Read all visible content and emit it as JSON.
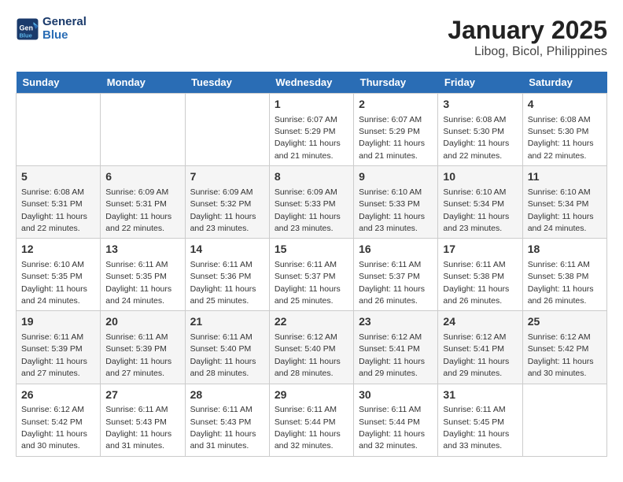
{
  "header": {
    "logo_line1": "General",
    "logo_line2": "Blue",
    "title": "January 2025",
    "subtitle": "Libog, Bicol, Philippines"
  },
  "days_of_week": [
    "Sunday",
    "Monday",
    "Tuesday",
    "Wednesday",
    "Thursday",
    "Friday",
    "Saturday"
  ],
  "weeks": [
    [
      {
        "day": "",
        "info": ""
      },
      {
        "day": "",
        "info": ""
      },
      {
        "day": "",
        "info": ""
      },
      {
        "day": "1",
        "sunrise": "6:07 AM",
        "sunset": "5:29 PM",
        "daylight": "11 hours and 21 minutes."
      },
      {
        "day": "2",
        "sunrise": "6:07 AM",
        "sunset": "5:29 PM",
        "daylight": "11 hours and 21 minutes."
      },
      {
        "day": "3",
        "sunrise": "6:08 AM",
        "sunset": "5:30 PM",
        "daylight": "11 hours and 22 minutes."
      },
      {
        "day": "4",
        "sunrise": "6:08 AM",
        "sunset": "5:30 PM",
        "daylight": "11 hours and 22 minutes."
      }
    ],
    [
      {
        "day": "5",
        "sunrise": "6:08 AM",
        "sunset": "5:31 PM",
        "daylight": "11 hours and 22 minutes."
      },
      {
        "day": "6",
        "sunrise": "6:09 AM",
        "sunset": "5:31 PM",
        "daylight": "11 hours and 22 minutes."
      },
      {
        "day": "7",
        "sunrise": "6:09 AM",
        "sunset": "5:32 PM",
        "daylight": "11 hours and 23 minutes."
      },
      {
        "day": "8",
        "sunrise": "6:09 AM",
        "sunset": "5:33 PM",
        "daylight": "11 hours and 23 minutes."
      },
      {
        "day": "9",
        "sunrise": "6:10 AM",
        "sunset": "5:33 PM",
        "daylight": "11 hours and 23 minutes."
      },
      {
        "day": "10",
        "sunrise": "6:10 AM",
        "sunset": "5:34 PM",
        "daylight": "11 hours and 23 minutes."
      },
      {
        "day": "11",
        "sunrise": "6:10 AM",
        "sunset": "5:34 PM",
        "daylight": "11 hours and 24 minutes."
      }
    ],
    [
      {
        "day": "12",
        "sunrise": "6:10 AM",
        "sunset": "5:35 PM",
        "daylight": "11 hours and 24 minutes."
      },
      {
        "day": "13",
        "sunrise": "6:11 AM",
        "sunset": "5:35 PM",
        "daylight": "11 hours and 24 minutes."
      },
      {
        "day": "14",
        "sunrise": "6:11 AM",
        "sunset": "5:36 PM",
        "daylight": "11 hours and 25 minutes."
      },
      {
        "day": "15",
        "sunrise": "6:11 AM",
        "sunset": "5:37 PM",
        "daylight": "11 hours and 25 minutes."
      },
      {
        "day": "16",
        "sunrise": "6:11 AM",
        "sunset": "5:37 PM",
        "daylight": "11 hours and 26 minutes."
      },
      {
        "day": "17",
        "sunrise": "6:11 AM",
        "sunset": "5:38 PM",
        "daylight": "11 hours and 26 minutes."
      },
      {
        "day": "18",
        "sunrise": "6:11 AM",
        "sunset": "5:38 PM",
        "daylight": "11 hours and 26 minutes."
      }
    ],
    [
      {
        "day": "19",
        "sunrise": "6:11 AM",
        "sunset": "5:39 PM",
        "daylight": "11 hours and 27 minutes."
      },
      {
        "day": "20",
        "sunrise": "6:11 AM",
        "sunset": "5:39 PM",
        "daylight": "11 hours and 27 minutes."
      },
      {
        "day": "21",
        "sunrise": "6:11 AM",
        "sunset": "5:40 PM",
        "daylight": "11 hours and 28 minutes."
      },
      {
        "day": "22",
        "sunrise": "6:12 AM",
        "sunset": "5:40 PM",
        "daylight": "11 hours and 28 minutes."
      },
      {
        "day": "23",
        "sunrise": "6:12 AM",
        "sunset": "5:41 PM",
        "daylight": "11 hours and 29 minutes."
      },
      {
        "day": "24",
        "sunrise": "6:12 AM",
        "sunset": "5:41 PM",
        "daylight": "11 hours and 29 minutes."
      },
      {
        "day": "25",
        "sunrise": "6:12 AM",
        "sunset": "5:42 PM",
        "daylight": "11 hours and 30 minutes."
      }
    ],
    [
      {
        "day": "26",
        "sunrise": "6:12 AM",
        "sunset": "5:42 PM",
        "daylight": "11 hours and 30 minutes."
      },
      {
        "day": "27",
        "sunrise": "6:11 AM",
        "sunset": "5:43 PM",
        "daylight": "11 hours and 31 minutes."
      },
      {
        "day": "28",
        "sunrise": "6:11 AM",
        "sunset": "5:43 PM",
        "daylight": "11 hours and 31 minutes."
      },
      {
        "day": "29",
        "sunrise": "6:11 AM",
        "sunset": "5:44 PM",
        "daylight": "11 hours and 32 minutes."
      },
      {
        "day": "30",
        "sunrise": "6:11 AM",
        "sunset": "5:44 PM",
        "daylight": "11 hours and 32 minutes."
      },
      {
        "day": "31",
        "sunrise": "6:11 AM",
        "sunset": "5:45 PM",
        "daylight": "11 hours and 33 minutes."
      },
      {
        "day": "",
        "info": ""
      }
    ]
  ],
  "labels": {
    "sunrise": "Sunrise:",
    "sunset": "Sunset:",
    "daylight": "Daylight:"
  }
}
